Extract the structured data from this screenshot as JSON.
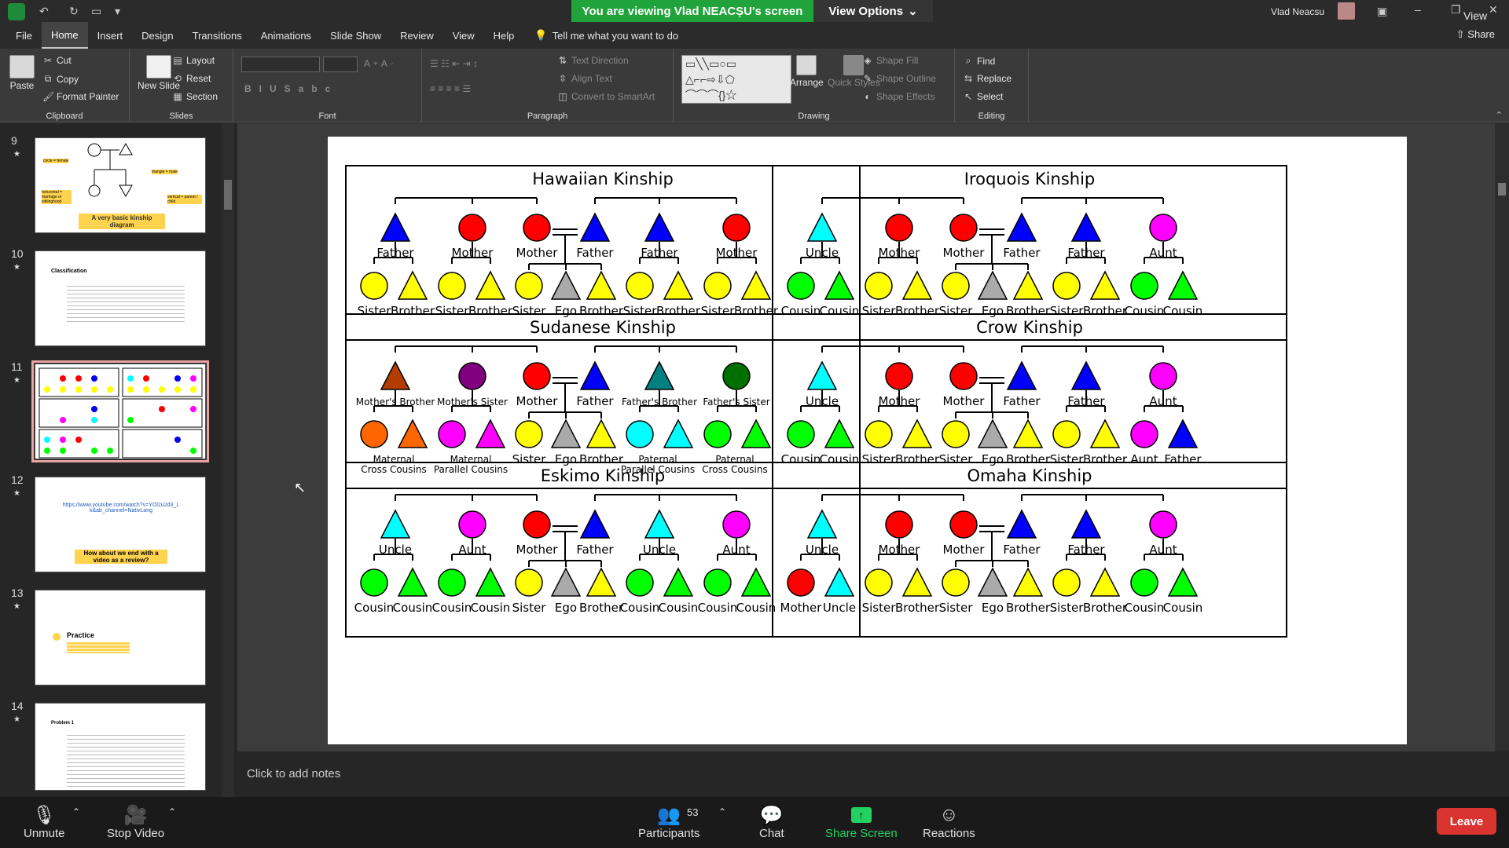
{
  "titlebar": {
    "banner": "You are viewing Vlad NEACȘU's screen",
    "view_options": "View Options",
    "user_name": "Vlad Neacsu",
    "view_label": "View",
    "share_label": "Share"
  },
  "tabs": [
    "File",
    "Home",
    "Insert",
    "Design",
    "Transitions",
    "Animations",
    "Slide Show",
    "Review",
    "View",
    "Help"
  ],
  "tellme": "Tell me what you want to do",
  "ribbon": {
    "clipboard": {
      "label": "Clipboard",
      "paste": "Paste",
      "cut": "Cut",
      "copy": "Copy",
      "format_painter": "Format Painter"
    },
    "slides": {
      "label": "Slides",
      "new_slide": "New Slide",
      "layout": "Layout",
      "reset": "Reset",
      "section": "Section"
    },
    "font": {
      "label": "Font"
    },
    "paragraph": {
      "label": "Paragraph",
      "text_direction": "Text Direction",
      "align_text": "Align Text",
      "convert": "Convert to SmartArt"
    },
    "drawing": {
      "label": "Drawing",
      "arrange": "Arrange",
      "quick_styles": "Quick Styles",
      "shape_fill": "Shape Fill",
      "shape_outline": "Shape Outline",
      "shape_effects": "Shape Effects"
    },
    "editing": {
      "label": "Editing",
      "find": "Find",
      "replace": "Replace",
      "select": "Select"
    }
  },
  "thumbnails": [
    {
      "num": "9",
      "caption": "A very basic kinship diagram",
      "labels": [
        "circle = female",
        "triangle = male",
        "horizontal = marriage or siblinghood",
        "vertical = parent / child"
      ]
    },
    {
      "num": "10",
      "title": "Classification"
    },
    {
      "num": "11",
      "selected": true
    },
    {
      "num": "12",
      "link": "https://www.youtube.com/watch?v=YOl2u2d3_L k&ab_channel=NativLang",
      "caption": "How about we end with a video as a review?"
    },
    {
      "num": "13",
      "title": "Practice"
    },
    {
      "num": "14",
      "title": "Problem 1"
    }
  ],
  "notes_placeholder": "Click to add notes",
  "zoom": {
    "unmute": "Unmute",
    "stop_video": "Stop Video",
    "participants": "Participants",
    "participant_count": "53",
    "chat": "Chat",
    "share_screen": "Share Screen",
    "reactions": "Reactions",
    "leave": "Leave"
  },
  "colors": {
    "yellow": "#ffff00",
    "red": "#ff0000",
    "blue": "#0000ff",
    "cyan": "#00ffff",
    "magenta": "#ff00ff",
    "green": "#00ff00",
    "gray": "#aaaaaa",
    "brown": "#b33c00",
    "purple": "#800080",
    "teal": "#008080",
    "darkgreen": "#007000",
    "orange": "#ff6600",
    "accent_green": "#20a33a",
    "leave_red": "#d93430"
  },
  "panels": [
    {
      "title": "Hawaiian Kinship",
      "parents": [
        {
          "s": "t",
          "c": "blue",
          "l": "Father"
        },
        {
          "s": "c",
          "c": "red",
          "l": "Mother"
        },
        {
          "s": "c",
          "c": "red",
          "l": "Mother"
        },
        {
          "s": "t",
          "c": "blue",
          "l": "Father"
        },
        {
          "s": "t",
          "c": "blue",
          "l": "Father"
        },
        {
          "s": "c",
          "c": "red",
          "l": "Mother"
        }
      ],
      "children": [
        {
          "s": "c",
          "c": "yellow",
          "l": "Sister"
        },
        {
          "s": "t",
          "c": "yellow",
          "l": "Brother"
        },
        {
          "s": "c",
          "c": "yellow",
          "l": "Sister"
        },
        {
          "s": "t",
          "c": "yellow",
          "l": "Brother"
        },
        {
          "s": "c",
          "c": "yellow",
          "l": "Sister"
        },
        {
          "s": "t",
          "c": "gray",
          "l": "Ego"
        },
        {
          "s": "t",
          "c": "yellow",
          "l": "Brother"
        },
        {
          "s": "c",
          "c": "yellow",
          "l": "Sister"
        },
        {
          "s": "t",
          "c": "yellow",
          "l": "Brother"
        },
        {
          "s": "c",
          "c": "yellow",
          "l": "Sister"
        },
        {
          "s": "t",
          "c": "yellow",
          "l": "Brother"
        }
      ]
    },
    {
      "title": "Iroquois Kinship",
      "parents": [
        {
          "s": "t",
          "c": "cyan",
          "l": "Uncle"
        },
        {
          "s": "c",
          "c": "red",
          "l": "Mother"
        },
        {
          "s": "c",
          "c": "red",
          "l": "Mother"
        },
        {
          "s": "t",
          "c": "blue",
          "l": "Father"
        },
        {
          "s": "t",
          "c": "blue",
          "l": "Father"
        },
        {
          "s": "c",
          "c": "magenta",
          "l": "Aunt"
        }
      ],
      "children": [
        {
          "s": "c",
          "c": "green",
          "l": "Cousin"
        },
        {
          "s": "t",
          "c": "green",
          "l": "Cousin"
        },
        {
          "s": "c",
          "c": "yellow",
          "l": "Sister"
        },
        {
          "s": "t",
          "c": "yellow",
          "l": "Brother"
        },
        {
          "s": "c",
          "c": "yellow",
          "l": "Sister"
        },
        {
          "s": "t",
          "c": "gray",
          "l": "Ego"
        },
        {
          "s": "t",
          "c": "yellow",
          "l": "Brother"
        },
        {
          "s": "c",
          "c": "yellow",
          "l": "Sister"
        },
        {
          "s": "t",
          "c": "yellow",
          "l": "Brother"
        },
        {
          "s": "c",
          "c": "green",
          "l": "Cousin"
        },
        {
          "s": "t",
          "c": "green",
          "l": "Cousin"
        }
      ]
    },
    {
      "title": "Sudanese Kinship",
      "parents": [
        {
          "s": "t",
          "c": "brown",
          "l": "Mother's Brother"
        },
        {
          "s": "c",
          "c": "purple",
          "l": "Mother's Sister"
        },
        {
          "s": "c",
          "c": "red",
          "l": "Mother"
        },
        {
          "s": "t",
          "c": "blue",
          "l": "Father"
        },
        {
          "s": "t",
          "c": "teal",
          "l": "Father's Brother"
        },
        {
          "s": "c",
          "c": "darkgreen",
          "l": "Father's Sister"
        }
      ],
      "children": [
        {
          "s": "c",
          "c": "orange",
          "l": ""
        },
        {
          "s": "t",
          "c": "orange",
          "l": ""
        },
        {
          "s": "c",
          "c": "magenta",
          "l": ""
        },
        {
          "s": "t",
          "c": "magenta",
          "l": ""
        },
        {
          "s": "c",
          "c": "yellow",
          "l": "Sister"
        },
        {
          "s": "t",
          "c": "gray",
          "l": "Ego"
        },
        {
          "s": "t",
          "c": "yellow",
          "l": "Brother"
        },
        {
          "s": "c",
          "c": "cyan",
          "l": ""
        },
        {
          "s": "t",
          "c": "cyan",
          "l": ""
        },
        {
          "s": "c",
          "c": "green",
          "l": ""
        },
        {
          "s": "t",
          "c": "green",
          "l": ""
        }
      ],
      "groups": [
        {
          "l1": "Maternal",
          "l2": "Cross Cousins"
        },
        {
          "l1": "Maternal",
          "l2": "Parallel Cousins"
        },
        {
          "l1": "Paternal",
          "l2": "Parallel Cousins"
        },
        {
          "l1": "Paternal",
          "l2": "Cross Cousins"
        }
      ]
    },
    {
      "title": "Crow Kinship",
      "parents": [
        {
          "s": "t",
          "c": "cyan",
          "l": "Uncle"
        },
        {
          "s": "c",
          "c": "red",
          "l": "Mother"
        },
        {
          "s": "c",
          "c": "red",
          "l": "Mother"
        },
        {
          "s": "t",
          "c": "blue",
          "l": "Father"
        },
        {
          "s": "t",
          "c": "blue",
          "l": "Father"
        },
        {
          "s": "c",
          "c": "magenta",
          "l": "Aunt"
        }
      ],
      "children": [
        {
          "s": "c",
          "c": "green",
          "l": "Cousin"
        },
        {
          "s": "t",
          "c": "green",
          "l": "Cousin"
        },
        {
          "s": "c",
          "c": "yellow",
          "l": "Sister"
        },
        {
          "s": "t",
          "c": "yellow",
          "l": "Brother"
        },
        {
          "s": "c",
          "c": "yellow",
          "l": "Sister"
        },
        {
          "s": "t",
          "c": "gray",
          "l": "Ego"
        },
        {
          "s": "t",
          "c": "yellow",
          "l": "Brother"
        },
        {
          "s": "c",
          "c": "yellow",
          "l": "Sister"
        },
        {
          "s": "t",
          "c": "yellow",
          "l": "Brother"
        },
        {
          "s": "c",
          "c": "magenta",
          "l": "Aunt"
        },
        {
          "s": "t",
          "c": "blue",
          "l": "Father"
        }
      ]
    },
    {
      "title": "Eskimo Kinship",
      "parents": [
        {
          "s": "t",
          "c": "cyan",
          "l": "Uncle"
        },
        {
          "s": "c",
          "c": "magenta",
          "l": "Aunt"
        },
        {
          "s": "c",
          "c": "red",
          "l": "Mother"
        },
        {
          "s": "t",
          "c": "blue",
          "l": "Father"
        },
        {
          "s": "t",
          "c": "cyan",
          "l": "Uncle"
        },
        {
          "s": "c",
          "c": "magenta",
          "l": "Aunt"
        }
      ],
      "children": [
        {
          "s": "c",
          "c": "green",
          "l": "Cousin"
        },
        {
          "s": "t",
          "c": "green",
          "l": "Cousin"
        },
        {
          "s": "c",
          "c": "green",
          "l": "Cousin"
        },
        {
          "s": "t",
          "c": "green",
          "l": "Cousin"
        },
        {
          "s": "c",
          "c": "yellow",
          "l": "Sister"
        },
        {
          "s": "t",
          "c": "gray",
          "l": "Ego"
        },
        {
          "s": "t",
          "c": "yellow",
          "l": "Brother"
        },
        {
          "s": "c",
          "c": "green",
          "l": "Cousin"
        },
        {
          "s": "t",
          "c": "green",
          "l": "Cousin"
        },
        {
          "s": "c",
          "c": "green",
          "l": "Cousin"
        },
        {
          "s": "t",
          "c": "green",
          "l": "Cousin"
        }
      ]
    },
    {
      "title": "Omaha Kinship",
      "parents": [
        {
          "s": "t",
          "c": "cyan",
          "l": "Uncle"
        },
        {
          "s": "c",
          "c": "red",
          "l": "Mother"
        },
        {
          "s": "c",
          "c": "red",
          "l": "Mother"
        },
        {
          "s": "t",
          "c": "blue",
          "l": "Father"
        },
        {
          "s": "t",
          "c": "blue",
          "l": "Father"
        },
        {
          "s": "c",
          "c": "magenta",
          "l": "Aunt"
        }
      ],
      "children": [
        {
          "s": "c",
          "c": "red",
          "l": "Mother"
        },
        {
          "s": "t",
          "c": "cyan",
          "l": "Uncle"
        },
        {
          "s": "c",
          "c": "yellow",
          "l": "Sister"
        },
        {
          "s": "t",
          "c": "yellow",
          "l": "Brother"
        },
        {
          "s": "c",
          "c": "yellow",
          "l": "Sister"
        },
        {
          "s": "t",
          "c": "gray",
          "l": "Ego"
        },
        {
          "s": "t",
          "c": "yellow",
          "l": "Brother"
        },
        {
          "s": "c",
          "c": "yellow",
          "l": "Sister"
        },
        {
          "s": "t",
          "c": "yellow",
          "l": "Brother"
        },
        {
          "s": "c",
          "c": "green",
          "l": "Cousin"
        },
        {
          "s": "t",
          "c": "green",
          "l": "Cousin"
        }
      ]
    }
  ]
}
